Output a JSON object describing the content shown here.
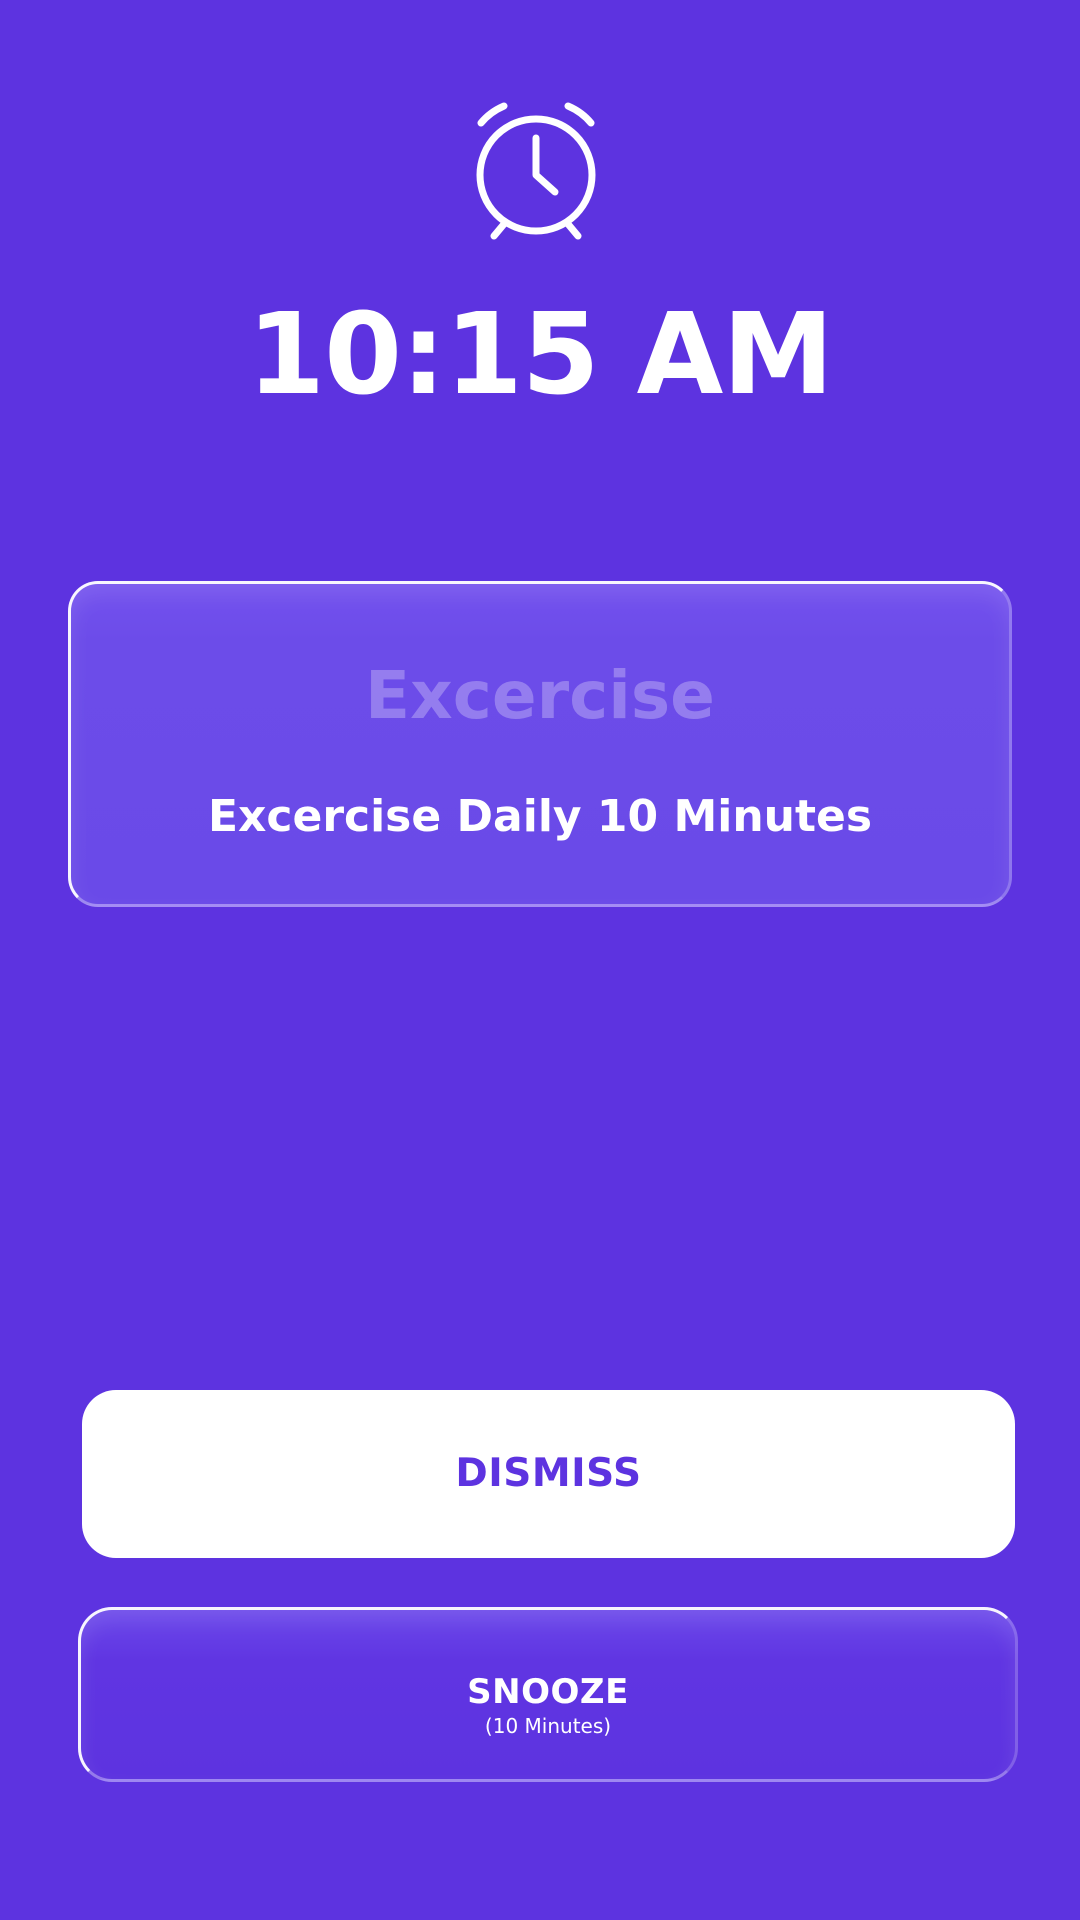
{
  "icon": {
    "alarm": "alarm-clock-icon"
  },
  "time": "10:15 AM",
  "alarm": {
    "title": "Excercise",
    "description": "Excercise Daily 10 Minutes"
  },
  "actions": {
    "dismiss_label": "DISMISS",
    "snooze_label": "SNOOZE",
    "snooze_sub": "(10 Minutes)"
  },
  "colors": {
    "background": "#5d33e0",
    "primary_text": "#ffffff",
    "dismiss_text": "#5d33e0"
  }
}
